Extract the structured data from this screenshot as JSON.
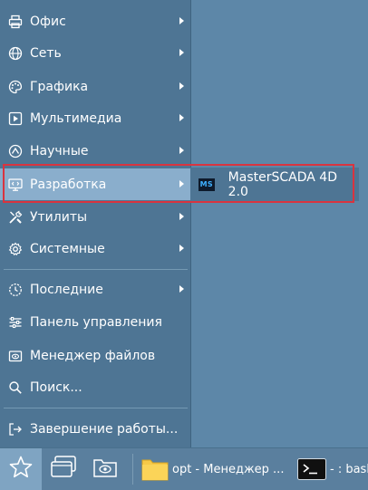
{
  "menu": {
    "items": [
      {
        "label": "Офис",
        "icon": "printer-icon",
        "submenu": true
      },
      {
        "label": "Сеть",
        "icon": "globe-icon",
        "submenu": true
      },
      {
        "label": "Графика",
        "icon": "palette-icon",
        "submenu": true
      },
      {
        "label": "Мультимедиа",
        "icon": "play-icon",
        "submenu": true
      },
      {
        "label": "Научные",
        "icon": "science-icon",
        "submenu": true
      },
      {
        "label": "Разработка",
        "icon": "dev-monitor-icon",
        "submenu": true,
        "active": true
      },
      {
        "label": "Утилиты",
        "icon": "tools-icon",
        "submenu": true
      },
      {
        "label": "Системные",
        "icon": "gear-icon",
        "submenu": true
      },
      {
        "label": "Последние",
        "icon": "history-icon",
        "submenu": true
      },
      {
        "label": "Панель управления",
        "icon": "sliders-icon",
        "submenu": false
      },
      {
        "label": "Менеджер файлов",
        "icon": "file-manager-icon",
        "submenu": false
      },
      {
        "label": "Поиск...",
        "icon": "search-icon",
        "submenu": false
      },
      {
        "label": "Завершение работы...",
        "icon": "logout-icon",
        "submenu": false
      }
    ]
  },
  "submenu": {
    "items": [
      {
        "label": "MasterSCADA 4D 2.0",
        "icon_text": "MS",
        "icon": "masterscada-icon"
      }
    ]
  },
  "taskbar": {
    "tasks": [
      {
        "label": "opt - Менеджер ...",
        "icon": "folder-icon"
      },
      {
        "label": "- : bash",
        "icon": "terminal-icon"
      }
    ]
  },
  "colors": {
    "desktop": "#5d87a8",
    "menu_bg": "#4e7594",
    "active_item": "#8aaecc",
    "highlight_border": "#d9343f",
    "folder": "#f7c948"
  }
}
